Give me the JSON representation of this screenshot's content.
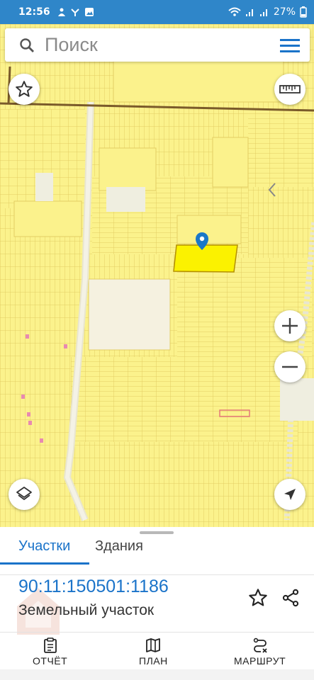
{
  "status_bar": {
    "time": "12:56",
    "battery": "27%"
  },
  "search": {
    "placeholder": "Поиск"
  },
  "map": {
    "colors": {
      "base": "#fbf28c",
      "parcel_line": "#e3cd63",
      "selected_parcel": "#fbf200",
      "marker": "#1a78c8"
    }
  },
  "sheet": {
    "tabs": [
      {
        "label": "Участки",
        "active": true
      },
      {
        "label": "Здания",
        "active": false
      }
    ],
    "parcel_id": "90:11:150501:1186",
    "parcel_type": "Земельный участок"
  },
  "bottom_nav": {
    "report": "ОТЧЁТ",
    "plan": "ПЛАН",
    "route": "МАРШРУТ"
  },
  "icons": [
    "search-icon",
    "menu-icon",
    "star-icon",
    "ruler-icon",
    "chevron-left-icon",
    "zoom-in-icon",
    "zoom-out-icon",
    "layers-icon",
    "navigate-icon",
    "share-icon",
    "clipboard-icon",
    "map-icon",
    "route-icon"
  ]
}
